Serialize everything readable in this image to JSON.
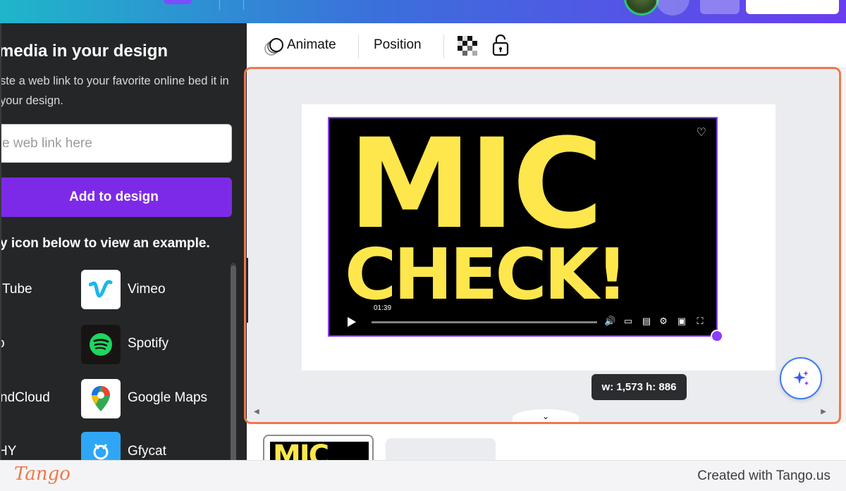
{
  "left_panel": {
    "title": "media in your design",
    "description": "ste a web link to your favorite online bed it in your design.",
    "input_placeholder": "e web link here",
    "add_button_label": "Add to design",
    "hint": "y icon below to view an example.",
    "items": [
      {
        "label": "Tube",
        "icon": "youtube-icon"
      },
      {
        "label": "Vimeo",
        "icon": "vimeo-icon"
      },
      {
        "label": "o",
        "icon": "partial-icon"
      },
      {
        "label": "Spotify",
        "icon": "spotify-icon"
      },
      {
        "label": "ndCloud",
        "icon": "soundcloud-icon"
      },
      {
        "label": "Google Maps",
        "icon": "google-maps-icon"
      },
      {
        "label": "HY",
        "icon": "giphy-icon"
      },
      {
        "label": "Gfycat",
        "icon": "gfycat-icon"
      }
    ]
  },
  "toolbar": {
    "animate_label": "Animate",
    "position_label": "Position"
  },
  "canvas": {
    "video_line1": "MIC",
    "video_line2": "CHECK!",
    "video_time": "01:39",
    "size_tooltip": "w: 1,573 h: 886"
  },
  "filmstrip": {
    "thumb_text": "MIC"
  },
  "footer": {
    "brand": "Tango",
    "credit": "Created with Tango.us"
  },
  "colors": {
    "accent_purple": "#7d2ae8",
    "highlight_orange": "#f0784a",
    "video_yellow": "#fde74c",
    "panel_dark": "#252627"
  }
}
